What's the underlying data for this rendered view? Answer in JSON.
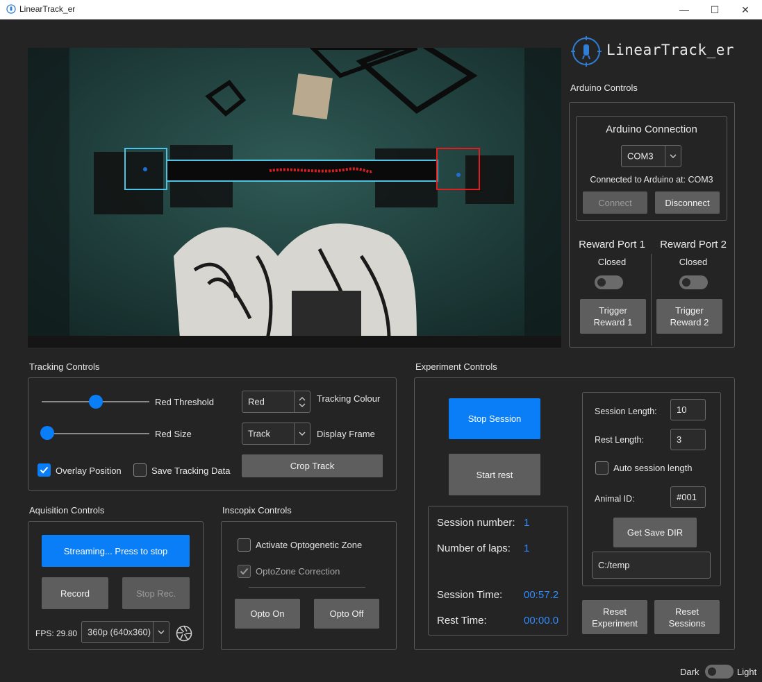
{
  "window": {
    "title": "LinearTrack_er",
    "minimize": "—",
    "maximize": "☐",
    "close": "✕"
  },
  "logo": {
    "text": "LinearTrack_er",
    "accent": "#2f7fd6"
  },
  "arduino": {
    "section_label": "Arduino Controls",
    "connection_title": "Arduino Connection",
    "port_value": "COM3",
    "status": "Connected to Arduino at: COM3",
    "connect_label": "Connect",
    "disconnect_label": "Disconnect",
    "port1": {
      "title": "Reward Port 1",
      "state": "Closed",
      "trigger_label": [
        "Trigger",
        "Reward 1"
      ]
    },
    "port2": {
      "title": "Reward Port 2",
      "state": "Closed",
      "trigger_label": [
        "Trigger",
        "Reward 2"
      ]
    }
  },
  "tracking": {
    "section_label": "Tracking Controls",
    "threshold_label": "Red Threshold",
    "threshold_level": 0.5,
    "size_label": "Red Size",
    "size_level": 0.05,
    "colour_value": "Red",
    "colour_label": "Tracking Colour",
    "frame_value": "Track",
    "frame_label": "Display Frame",
    "overlay_label": "Overlay Position",
    "overlay_checked": true,
    "save_label": "Save Tracking Data",
    "save_checked": false,
    "crop_label": "Crop Track"
  },
  "acquisition": {
    "section_label": "Aquisition Controls",
    "stream_label": "Streaming... Press to stop",
    "record_label": "Record",
    "stop_record_label": "Stop Rec.",
    "fps_text": "FPS: 29.80",
    "resolution_value": "360p (640x360)",
    "camera_icon": "aperture-icon"
  },
  "inscopix": {
    "section_label": "Inscopix Controls",
    "opto_zone_label": "Activate Optogenetic Zone",
    "opto_zone_checked": false,
    "opto_correction_label": "OptoZone Correction",
    "opto_correction_checked": true,
    "opto_on_label": "Opto On",
    "opto_off_label": "Opto Off"
  },
  "experiment": {
    "section_label": "Experiment Controls",
    "stop_session_label": "Stop Session",
    "start_rest_label": "Start rest",
    "session_number_label": "Session number:",
    "session_number": "1",
    "laps_label": "Number of laps:",
    "laps": "1",
    "session_time_label": "Session Time:",
    "session_time": "00:57.2",
    "rest_time_label": "Rest Time:",
    "rest_time": "00:00.0",
    "session_length_label": "Session Length:",
    "session_length": "10",
    "rest_length_label": "Rest Length:",
    "rest_length": "3",
    "auto_session_label": "Auto session length",
    "auto_session_checked": false,
    "animal_id_label": "Animal ID:",
    "animal_id": "#001",
    "get_dir_label": "Get Save DIR",
    "save_dir": "C:/temp",
    "reset_experiment_label": [
      "Reset",
      "Experiment"
    ],
    "reset_sessions_label": [
      "Reset",
      "Sessions"
    ]
  },
  "theme": {
    "dark_label": "Dark",
    "light_label": "Light"
  },
  "colors": {
    "accent": "#0a7ef7",
    "value_blue": "#2f8bff",
    "zone_cyan": "#4fc3e6",
    "zone_red": "#e02020",
    "background": "#242424"
  }
}
